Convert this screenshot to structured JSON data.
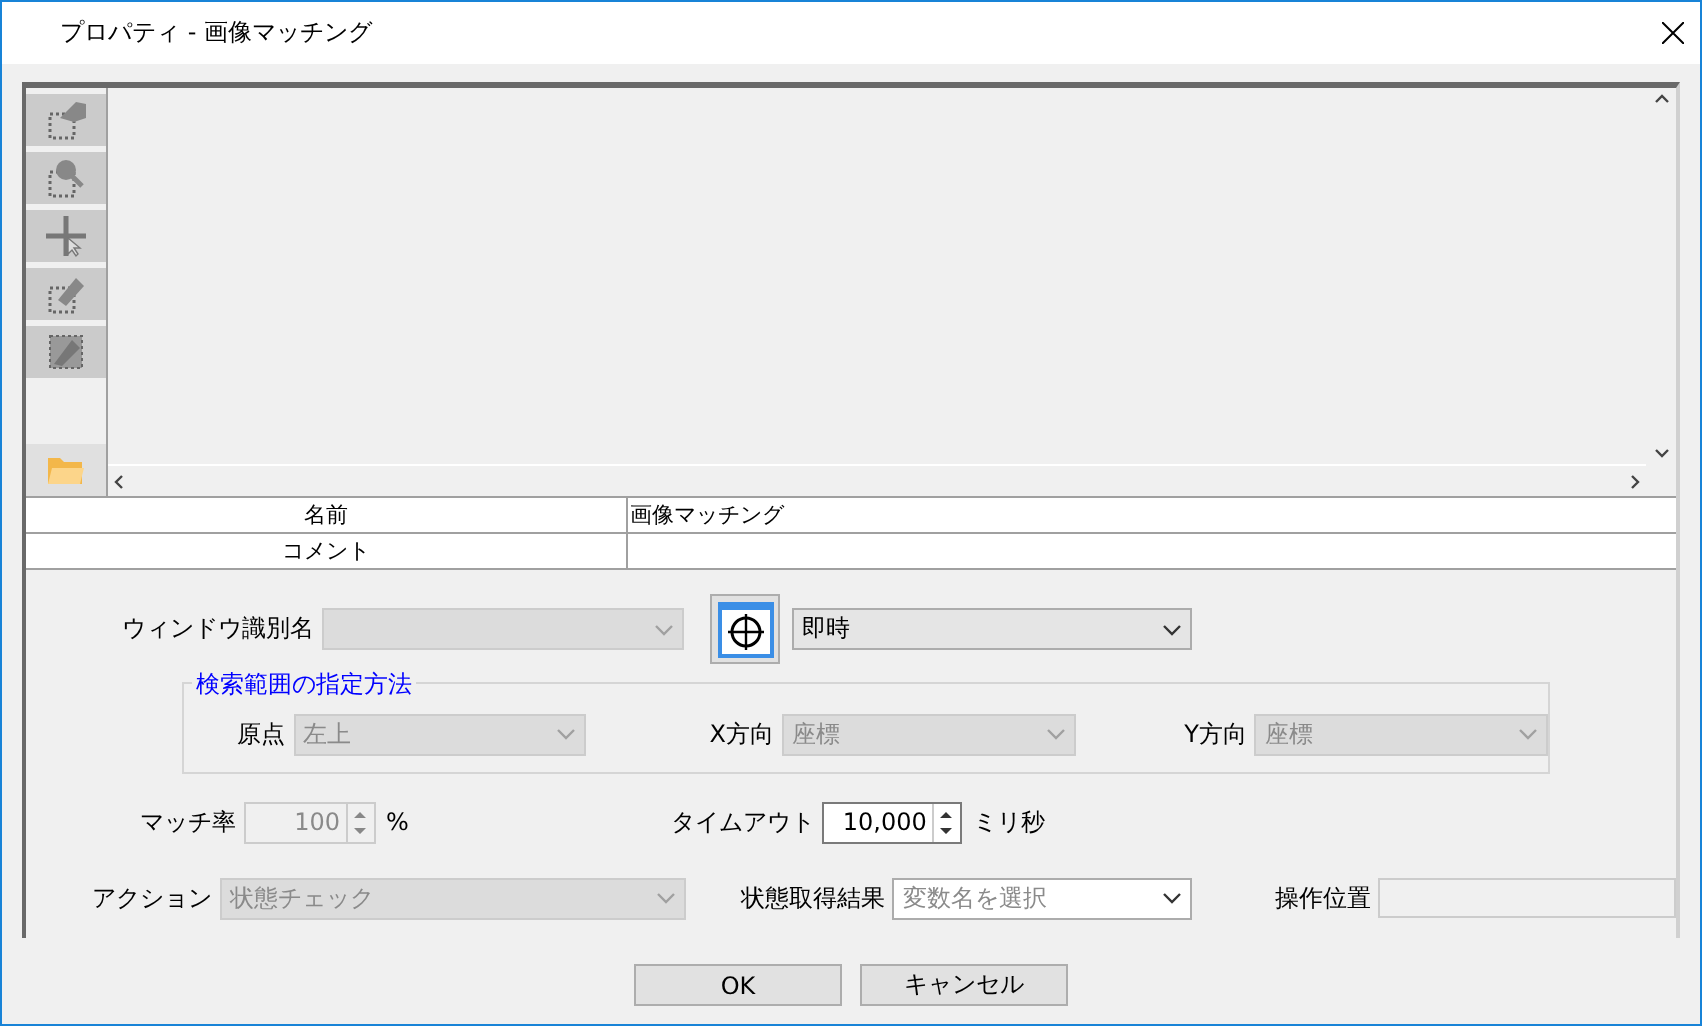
{
  "window": {
    "title": "プロパティ - 画像マッチング"
  },
  "tools": [
    {
      "kind": "area-hand",
      "disabled": true
    },
    {
      "kind": "area-zoom",
      "disabled": true
    },
    {
      "kind": "crosshair",
      "disabled": true
    },
    {
      "kind": "area-pen",
      "disabled": true
    },
    {
      "kind": "pen-area",
      "disabled": true
    },
    {
      "kind": "folder",
      "disabled": false
    }
  ],
  "properties": [
    {
      "label": "名前",
      "value": "画像マッチング"
    },
    {
      "label": "コメント"
    }
  ],
  "window_id": {
    "label": "ウィンドウ識別名",
    "disabled": true,
    "timing": "即時"
  },
  "search_range": {
    "title": "検索範囲の指定方法",
    "fields": [
      {
        "label": "原点",
        "value": "左上",
        "disabled": true
      },
      {
        "label": "X方向",
        "value": "座標",
        "disabled": true
      },
      {
        "label": "Y方向",
        "value": "座標",
        "disabled": true
      }
    ]
  },
  "match_rate": {
    "label": "マッチ率",
    "value": "100",
    "unit": "%",
    "disabled": true
  },
  "timeout": {
    "label": "タイムアウト",
    "value": "10,000",
    "unit": "ミリ秒",
    "disabled": false
  },
  "action": {
    "label": "アクション",
    "value": "状態チェック",
    "disabled": true
  },
  "result": {
    "label": "状態取得結果",
    "placeholder": "変数名を選択"
  },
  "position": {
    "label": "操作位置",
    "disabled": true
  },
  "buttons": [
    "OK",
    "キャンセル"
  ]
}
